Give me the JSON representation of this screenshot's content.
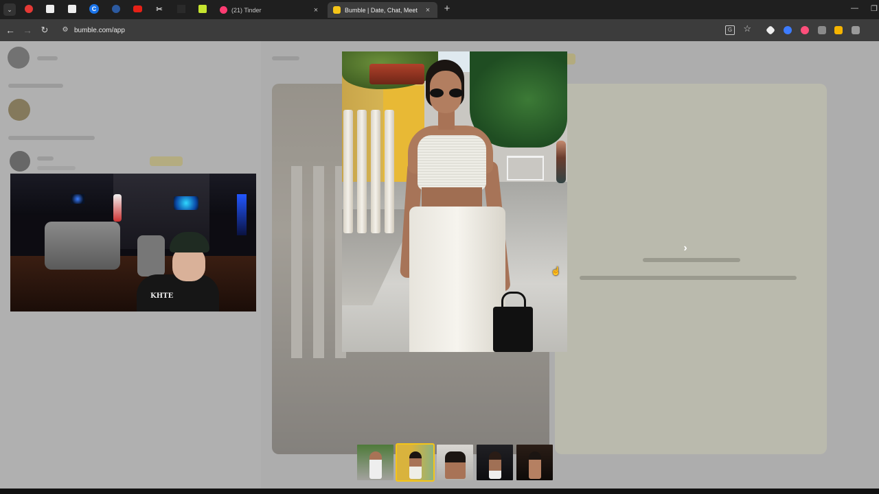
{
  "browser": {
    "tabs": [
      {
        "title": "(21) Tinder",
        "favicon": "tinder-icon",
        "color": "#fe3c72",
        "active": false
      },
      {
        "title": "Bumble | Date, Chat, Meet New",
        "favicon": "bumble-icon",
        "color": "#f5c518",
        "active": true
      }
    ],
    "pinned": [
      {
        "icon": "shield-icon",
        "color": "#e53935"
      },
      {
        "icon": "sheet-icon",
        "color": "#f0f0f0"
      },
      {
        "icon": "sheet-icon",
        "color": "#f0f0f0"
      },
      {
        "icon": "c-icon",
        "color": "#1a73e8",
        "text": "C"
      },
      {
        "icon": "globe-icon",
        "color": "#2c5aa0"
      },
      {
        "icon": "youtube-icon",
        "color": "#e62117"
      },
      {
        "icon": "tool-icon",
        "color": "#bbbbbb"
      },
      {
        "icon": "blank-icon",
        "color": "#2a2a2a"
      },
      {
        "icon": "note-icon",
        "color": "#c6e52f"
      }
    ],
    "url": "bumble.com/app",
    "new_tab": "+",
    "close": "×",
    "extensions": [
      {
        "icon": "diamond-extension-icon",
        "color": "#eeeeee"
      },
      {
        "icon": "wave-extension-icon",
        "color": "#3d7cff"
      },
      {
        "icon": "heart-extension-icon",
        "color": "#ff4f7b"
      },
      {
        "icon": "script-extension-icon",
        "color": "#cccccc"
      },
      {
        "icon": "lock-extension-icon",
        "color": "#f5b400"
      },
      {
        "icon": "puzzle-extension-icon",
        "color": "#cccccc"
      }
    ]
  },
  "viewer": {
    "next_glyph": "›",
    "cursor_glyph": "☝"
  },
  "webcam": {
    "shirt_text": "KHTE"
  },
  "colors": {
    "accent": "#f5c518",
    "page_bg": "#dedede"
  }
}
